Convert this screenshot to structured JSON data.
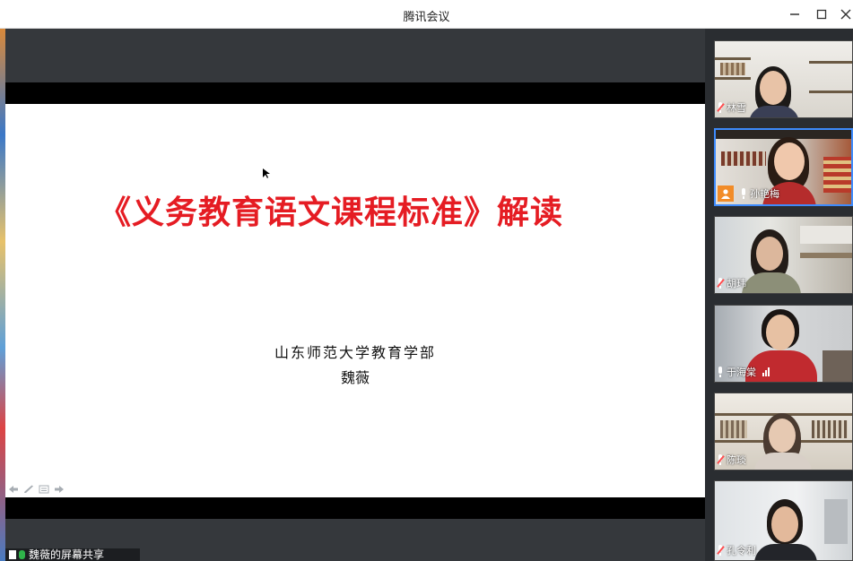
{
  "window": {
    "title": "腾讯会议",
    "minimize_icon": "minimize-icon",
    "maximize_icon": "maximize-icon",
    "close_icon": "close-icon"
  },
  "slide": {
    "title": "《义务教育语文课程标准》解读",
    "subtitle": "山东师范大学教育学部",
    "presenter": "魏薇",
    "title_color": "#e51c23"
  },
  "slide_tools": [
    "prev-arrow-icon",
    "pen-icon",
    "menu-icon",
    "next-arrow-icon"
  ],
  "share_label": "魏薇的屏幕共享",
  "participants": [
    {
      "name": "林雪",
      "mic": "muted",
      "host": false
    },
    {
      "name": "孙艳梅",
      "mic": "muted",
      "host": true
    },
    {
      "name": "胡玮",
      "mic": "muted",
      "host": false
    },
    {
      "name": "于海棠",
      "mic": "speaking",
      "host": false
    },
    {
      "name": "陈琰",
      "mic": "muted",
      "host": false
    },
    {
      "name": "孔令利",
      "mic": "muted",
      "host": false
    }
  ]
}
